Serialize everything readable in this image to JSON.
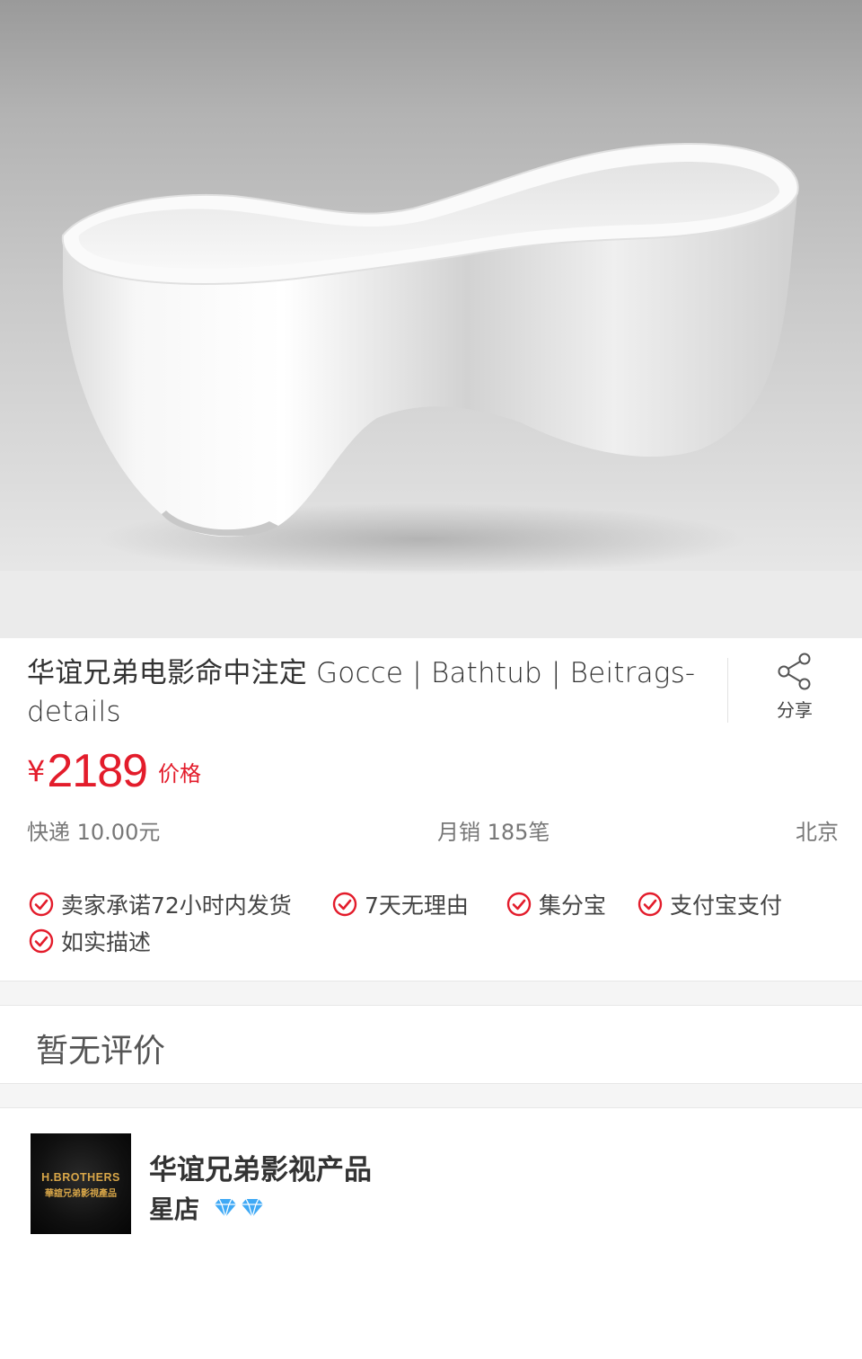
{
  "product": {
    "image_alt": "white freestanding bathtub",
    "title": "华谊兄弟电影命中注定 Gocce | Bathtub | Beitrags-details",
    "price_currency": "¥",
    "price_amount": "2189",
    "price_label": "价格"
  },
  "share": {
    "label": "分享",
    "icon": "share-icon"
  },
  "meta": {
    "shipping": "快递 10.00元",
    "sales": "月销 185笔",
    "location": "北京"
  },
  "guarantees": [
    {
      "label": "卖家承诺72小时内发货",
      "icon": "check-circle-icon"
    },
    {
      "label": "7天无理由",
      "icon": "check-circle-icon"
    },
    {
      "label": "集分宝",
      "icon": "check-circle-icon"
    },
    {
      "label": "支付宝支付",
      "icon": "check-circle-icon"
    },
    {
      "label": "如实描述",
      "icon": "check-circle-icon"
    }
  ],
  "reviews": {
    "empty_text": "暂无评价"
  },
  "shop": {
    "logo_text_1": "H.BROTHERS",
    "logo_text_2": "華誼兄弟影視產品",
    "name": "华谊兄弟影视产品",
    "tier": "星店",
    "diamonds": 2
  },
  "colors": {
    "price": "#e31c2b",
    "check": "#e31c2b",
    "diamond": "#3fa9f5",
    "separator": "#f5f5f5"
  }
}
